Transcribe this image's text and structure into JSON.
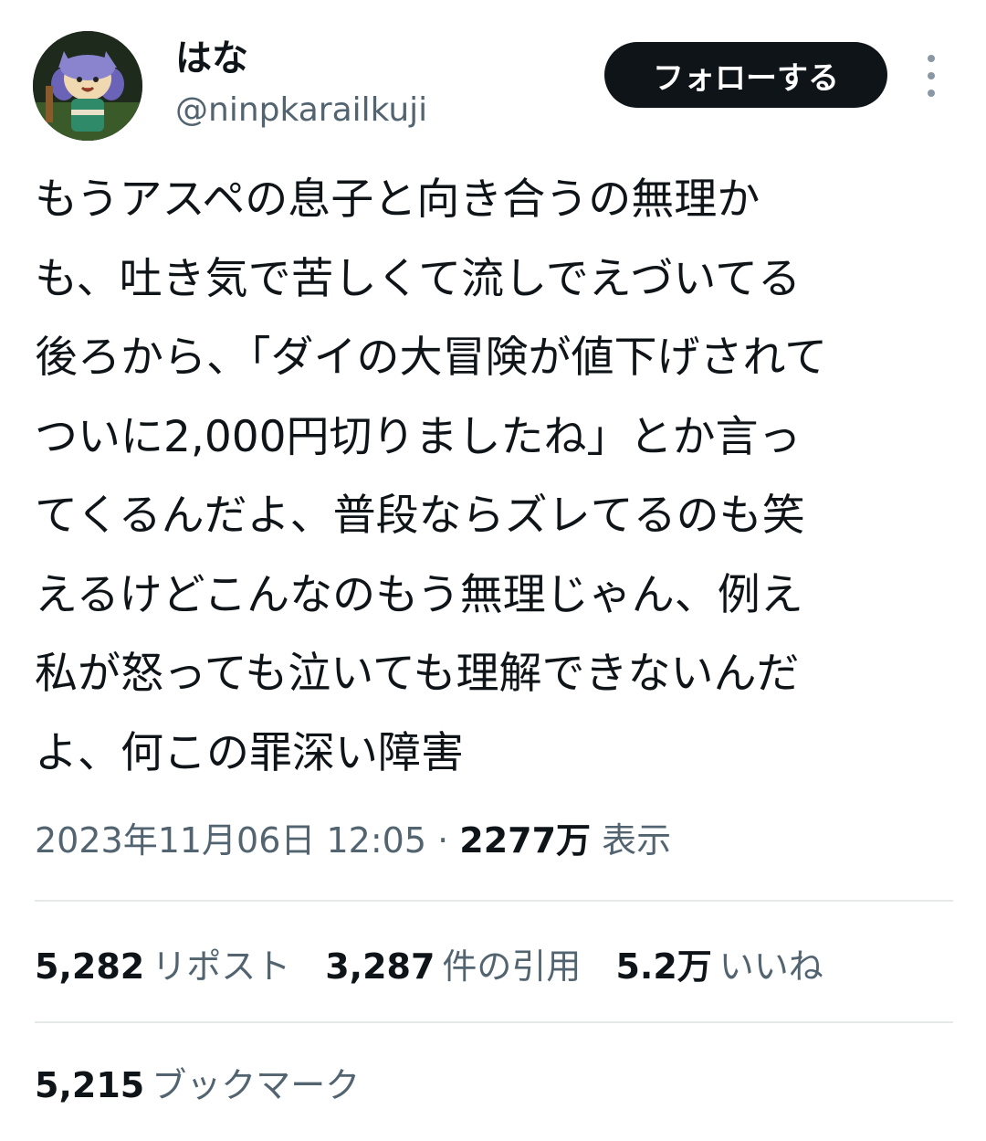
{
  "author": {
    "display_name": "はな",
    "handle": "@ninpkarailkuji",
    "avatar_icon": "cartoon-cat-avatar"
  },
  "follow_button": {
    "label": "フォローする"
  },
  "more_menu_icon": "vertical-ellipsis-icon",
  "tweet": {
    "lines": [
      "もうアスペの息子と向き合うの無理か",
      "も、吐き気で苦しくて流しでえづいてる",
      "後ろから、「ダイの大冒険が値下げされて",
      "ついに2,000円切りましたね」とか言っ",
      "てくるんだよ、普段ならズレてるのも笑",
      "えるけどこんなのもう無理じゃん、例え",
      "私が怒っても泣いても理解できないんだ",
      "よ、何この罪深い障害"
    ]
  },
  "meta": {
    "timestamp": "2023年11月06日 12:05",
    "separator": " · ",
    "views_count": "2277万",
    "views_label": "表示"
  },
  "stats": {
    "reposts": {
      "count": "5,282",
      "label": "リポスト"
    },
    "quotes": {
      "count": "3,287",
      "label": "件の引用"
    },
    "likes": {
      "count": "5.2万",
      "label": "いいね"
    },
    "bookmarks": {
      "count": "5,215",
      "label": "ブックマーク"
    }
  },
  "colors": {
    "text": "#0f1419",
    "secondary": "#536471",
    "button_bg": "#0f1419",
    "divider": "#e6e9ea"
  }
}
